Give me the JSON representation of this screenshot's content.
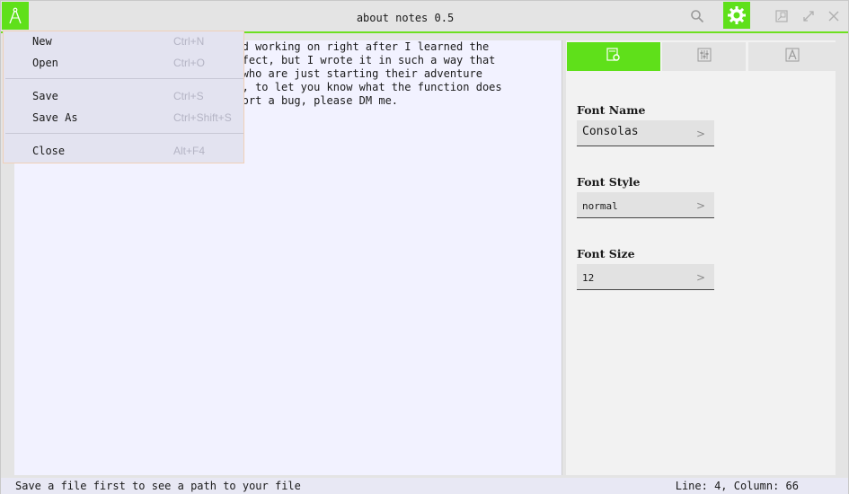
{
  "window": {
    "title": "about notes 0.5"
  },
  "titlebar": {
    "logo_icon": "compass-logo-icon",
    "search_icon": "search-icon",
    "settings_icon": "gear-icon",
    "window_buttons": [
      "restore-window-icon",
      "maximize-icon",
      "close-icon"
    ],
    "accent_color": "#5fe01a"
  },
  "editor": {
    "lines": [
      "                            started working on right after I learned the",
      "                            ot perfect, but I wrote it in such a way that",
      "                            eople who are just starting their adventure",
      "                            mments, to let you know what the function does",
      "                            to report a bug, please DM me."
    ]
  },
  "file_menu": {
    "items": [
      {
        "label": "New",
        "shortcut": "Ctrl+N"
      },
      {
        "label": "Open",
        "shortcut": "Ctrl+O"
      },
      {
        "label": "Save",
        "shortcut": "Ctrl+S"
      },
      {
        "label": "Save As",
        "shortcut": "Ctrl+Shift+S"
      },
      {
        "label": "Close",
        "shortcut": "Alt+F4"
      }
    ]
  },
  "settings_panel": {
    "tabs": [
      {
        "icon": "font-settings-icon",
        "active": true
      },
      {
        "icon": "sliders-icon",
        "active": false
      },
      {
        "icon": "text-style-icon",
        "active": false
      }
    ],
    "font_name": {
      "label": "Font Name",
      "value": "Consolas"
    },
    "font_style": {
      "label": "Font Style",
      "value": "normal"
    },
    "font_size": {
      "label": "Font Size",
      "value": "12"
    },
    "chevron": ">"
  },
  "statusbar": {
    "path_text": "Save a file first to see a path to your file",
    "position_text": "Line: 4, Column: 66"
  }
}
